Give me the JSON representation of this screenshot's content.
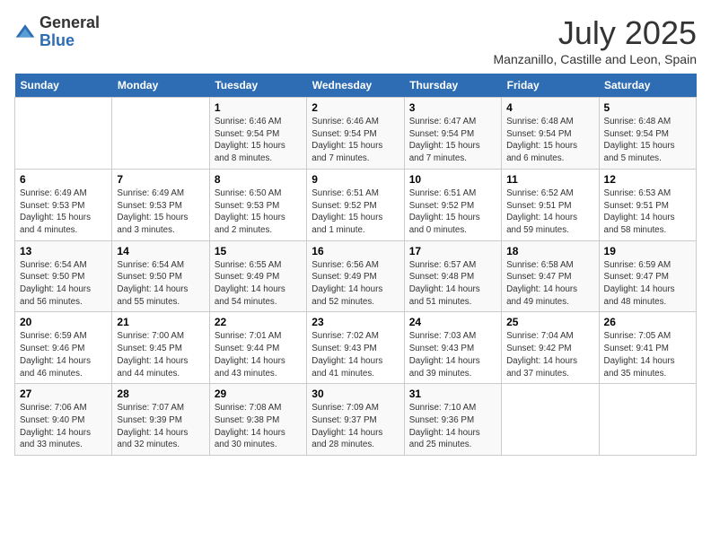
{
  "logo": {
    "general": "General",
    "blue": "Blue"
  },
  "title": "July 2025",
  "subtitle": "Manzanillo, Castille and Leon, Spain",
  "days_of_week": [
    "Sunday",
    "Monday",
    "Tuesday",
    "Wednesday",
    "Thursday",
    "Friday",
    "Saturday"
  ],
  "weeks": [
    [
      {
        "day": "",
        "info": ""
      },
      {
        "day": "",
        "info": ""
      },
      {
        "day": "1",
        "info": "Sunrise: 6:46 AM\nSunset: 9:54 PM\nDaylight: 15 hours and 8 minutes."
      },
      {
        "day": "2",
        "info": "Sunrise: 6:46 AM\nSunset: 9:54 PM\nDaylight: 15 hours and 7 minutes."
      },
      {
        "day": "3",
        "info": "Sunrise: 6:47 AM\nSunset: 9:54 PM\nDaylight: 15 hours and 7 minutes."
      },
      {
        "day": "4",
        "info": "Sunrise: 6:48 AM\nSunset: 9:54 PM\nDaylight: 15 hours and 6 minutes."
      },
      {
        "day": "5",
        "info": "Sunrise: 6:48 AM\nSunset: 9:54 PM\nDaylight: 15 hours and 5 minutes."
      }
    ],
    [
      {
        "day": "6",
        "info": "Sunrise: 6:49 AM\nSunset: 9:53 PM\nDaylight: 15 hours and 4 minutes."
      },
      {
        "day": "7",
        "info": "Sunrise: 6:49 AM\nSunset: 9:53 PM\nDaylight: 15 hours and 3 minutes."
      },
      {
        "day": "8",
        "info": "Sunrise: 6:50 AM\nSunset: 9:53 PM\nDaylight: 15 hours and 2 minutes."
      },
      {
        "day": "9",
        "info": "Sunrise: 6:51 AM\nSunset: 9:52 PM\nDaylight: 15 hours and 1 minute."
      },
      {
        "day": "10",
        "info": "Sunrise: 6:51 AM\nSunset: 9:52 PM\nDaylight: 15 hours and 0 minutes."
      },
      {
        "day": "11",
        "info": "Sunrise: 6:52 AM\nSunset: 9:51 PM\nDaylight: 14 hours and 59 minutes."
      },
      {
        "day": "12",
        "info": "Sunrise: 6:53 AM\nSunset: 9:51 PM\nDaylight: 14 hours and 58 minutes."
      }
    ],
    [
      {
        "day": "13",
        "info": "Sunrise: 6:54 AM\nSunset: 9:50 PM\nDaylight: 14 hours and 56 minutes."
      },
      {
        "day": "14",
        "info": "Sunrise: 6:54 AM\nSunset: 9:50 PM\nDaylight: 14 hours and 55 minutes."
      },
      {
        "day": "15",
        "info": "Sunrise: 6:55 AM\nSunset: 9:49 PM\nDaylight: 14 hours and 54 minutes."
      },
      {
        "day": "16",
        "info": "Sunrise: 6:56 AM\nSunset: 9:49 PM\nDaylight: 14 hours and 52 minutes."
      },
      {
        "day": "17",
        "info": "Sunrise: 6:57 AM\nSunset: 9:48 PM\nDaylight: 14 hours and 51 minutes."
      },
      {
        "day": "18",
        "info": "Sunrise: 6:58 AM\nSunset: 9:47 PM\nDaylight: 14 hours and 49 minutes."
      },
      {
        "day": "19",
        "info": "Sunrise: 6:59 AM\nSunset: 9:47 PM\nDaylight: 14 hours and 48 minutes."
      }
    ],
    [
      {
        "day": "20",
        "info": "Sunrise: 6:59 AM\nSunset: 9:46 PM\nDaylight: 14 hours and 46 minutes."
      },
      {
        "day": "21",
        "info": "Sunrise: 7:00 AM\nSunset: 9:45 PM\nDaylight: 14 hours and 44 minutes."
      },
      {
        "day": "22",
        "info": "Sunrise: 7:01 AM\nSunset: 9:44 PM\nDaylight: 14 hours and 43 minutes."
      },
      {
        "day": "23",
        "info": "Sunrise: 7:02 AM\nSunset: 9:43 PM\nDaylight: 14 hours and 41 minutes."
      },
      {
        "day": "24",
        "info": "Sunrise: 7:03 AM\nSunset: 9:43 PM\nDaylight: 14 hours and 39 minutes."
      },
      {
        "day": "25",
        "info": "Sunrise: 7:04 AM\nSunset: 9:42 PM\nDaylight: 14 hours and 37 minutes."
      },
      {
        "day": "26",
        "info": "Sunrise: 7:05 AM\nSunset: 9:41 PM\nDaylight: 14 hours and 35 minutes."
      }
    ],
    [
      {
        "day": "27",
        "info": "Sunrise: 7:06 AM\nSunset: 9:40 PM\nDaylight: 14 hours and 33 minutes."
      },
      {
        "day": "28",
        "info": "Sunrise: 7:07 AM\nSunset: 9:39 PM\nDaylight: 14 hours and 32 minutes."
      },
      {
        "day": "29",
        "info": "Sunrise: 7:08 AM\nSunset: 9:38 PM\nDaylight: 14 hours and 30 minutes."
      },
      {
        "day": "30",
        "info": "Sunrise: 7:09 AM\nSunset: 9:37 PM\nDaylight: 14 hours and 28 minutes."
      },
      {
        "day": "31",
        "info": "Sunrise: 7:10 AM\nSunset: 9:36 PM\nDaylight: 14 hours and 25 minutes."
      },
      {
        "day": "",
        "info": ""
      },
      {
        "day": "",
        "info": ""
      }
    ]
  ]
}
